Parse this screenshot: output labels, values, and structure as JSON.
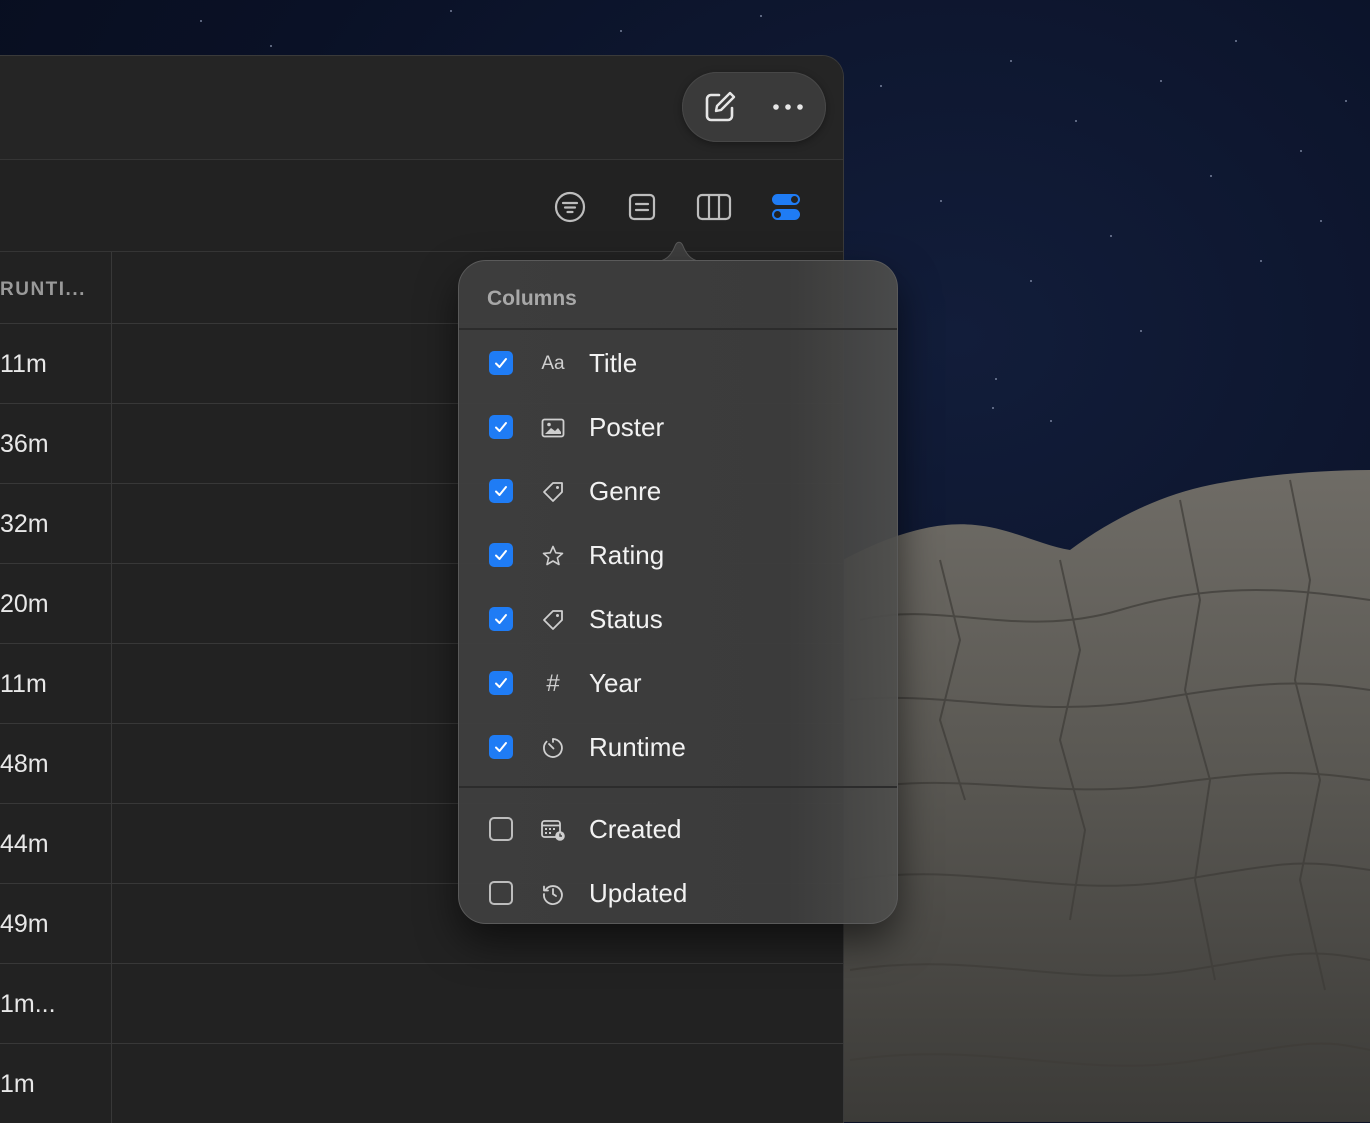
{
  "table": {
    "header_label": "RUNTI...",
    "rows": [
      "11m",
      "36m",
      "32m",
      "20m",
      "11m",
      "48m",
      "44m",
      "49m",
      "1m...",
      "1m"
    ]
  },
  "titlebar": {
    "icons": [
      "compose-icon",
      "more-icon"
    ]
  },
  "toolbar": {
    "icons": [
      "filter-icon",
      "list-view-icon",
      "columns-view-icon",
      "toggle-columns-icon"
    ],
    "active_color": "#1f7cf5"
  },
  "columns_popover": {
    "title": "Columns",
    "items": [
      {
        "label": "Title",
        "checked": true,
        "icon": "text-type-icon",
        "glyph": "Aa"
      },
      {
        "label": "Poster",
        "checked": true,
        "icon": "image-icon"
      },
      {
        "label": "Genre",
        "checked": true,
        "icon": "tag-icon"
      },
      {
        "label": "Rating",
        "checked": true,
        "icon": "star-icon"
      },
      {
        "label": "Status",
        "checked": true,
        "icon": "tag-icon"
      },
      {
        "label": "Year",
        "checked": true,
        "icon": "number-icon",
        "glyph": "#"
      },
      {
        "label": "Runtime",
        "checked": true,
        "icon": "timer-icon"
      },
      {
        "label": "Created",
        "checked": false,
        "icon": "calendar-clock-icon"
      },
      {
        "label": "Updated",
        "checked": false,
        "icon": "history-icon"
      }
    ]
  }
}
